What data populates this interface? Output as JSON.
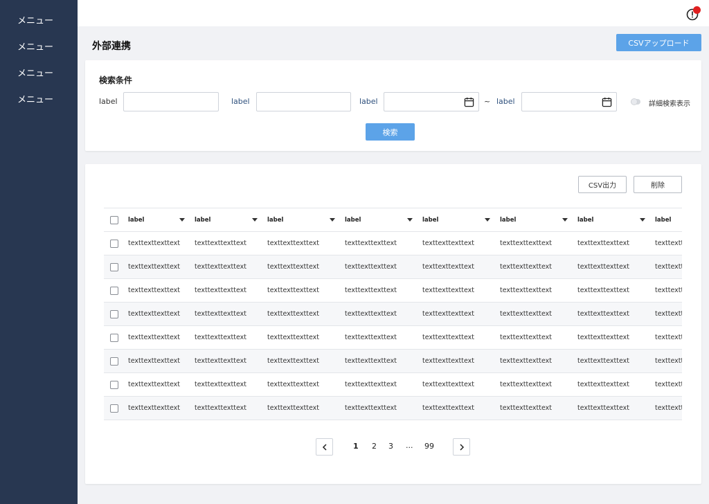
{
  "sidebar": {
    "items": [
      {
        "label": "メニュー"
      },
      {
        "label": "メニュー"
      },
      {
        "label": "メニュー"
      },
      {
        "label": "メニュー"
      }
    ]
  },
  "header": {
    "title": "外部連携",
    "upload_label": "CSVアップロード",
    "alert_icon": "alert-circle-icon",
    "alert_dot_color": "#e02020"
  },
  "search": {
    "title": "検索条件",
    "label1": "label",
    "label2": "label",
    "label3": "label",
    "label4": "label",
    "range_separator": "~",
    "toggle_label": "詳細検索表示",
    "submit_label": "検索",
    "accent_color": "#5ca3e8"
  },
  "results": {
    "csv_export_label": "CSV出力",
    "delete_label": "削除",
    "columns": [
      "label",
      "label",
      "label",
      "label",
      "label",
      "label",
      "label",
      "label"
    ],
    "rows": [
      [
        "texttexttexttext",
        "texttexttexttext",
        "texttexttexttext",
        "texttexttexttext",
        "texttexttexttext",
        "texttexttexttext",
        "texttexttexttext",
        "texttexttexttext"
      ],
      [
        "texttexttexttext",
        "texttexttexttext",
        "texttexttexttext",
        "texttexttexttext",
        "texttexttexttext",
        "texttexttexttext",
        "texttexttexttext",
        "texttexttexttext"
      ],
      [
        "texttexttexttext",
        "texttexttexttext",
        "texttexttexttext",
        "texttexttexttext",
        "texttexttexttext",
        "texttexttexttext",
        "texttexttexttext",
        "texttexttexttext"
      ],
      [
        "texttexttexttext",
        "texttexttexttext",
        "texttexttexttext",
        "texttexttexttext",
        "texttexttexttext",
        "texttexttexttext",
        "texttexttexttext",
        "texttexttexttext"
      ],
      [
        "texttexttexttext",
        "texttexttexttext",
        "texttexttexttext",
        "texttexttexttext",
        "texttexttexttext",
        "texttexttexttext",
        "texttexttexttext",
        "texttexttexttext"
      ],
      [
        "texttexttexttext",
        "texttexttexttext",
        "texttexttexttext",
        "texttexttexttext",
        "texttexttexttext",
        "texttexttexttext",
        "texttexttexttext",
        "texttexttexttext"
      ],
      [
        "texttexttexttext",
        "texttexttexttext",
        "texttexttexttext",
        "texttexttexttext",
        "texttexttexttext",
        "texttexttexttext",
        "texttexttexttext",
        "texttexttexttext"
      ],
      [
        "texttexttexttext",
        "texttexttexttext",
        "texttexttexttext",
        "texttexttexttext",
        "texttexttexttext",
        "texttexttexttext",
        "texttexttexttext",
        "texttexttexttext"
      ]
    ]
  },
  "pagination": {
    "pages": [
      "1",
      "2",
      "3",
      "...",
      "99"
    ],
    "current": "1"
  },
  "colors": {
    "sidebar_bg": "#283751",
    "page_bg": "#f1f2f5",
    "label_blue": "#2d4f7c"
  }
}
